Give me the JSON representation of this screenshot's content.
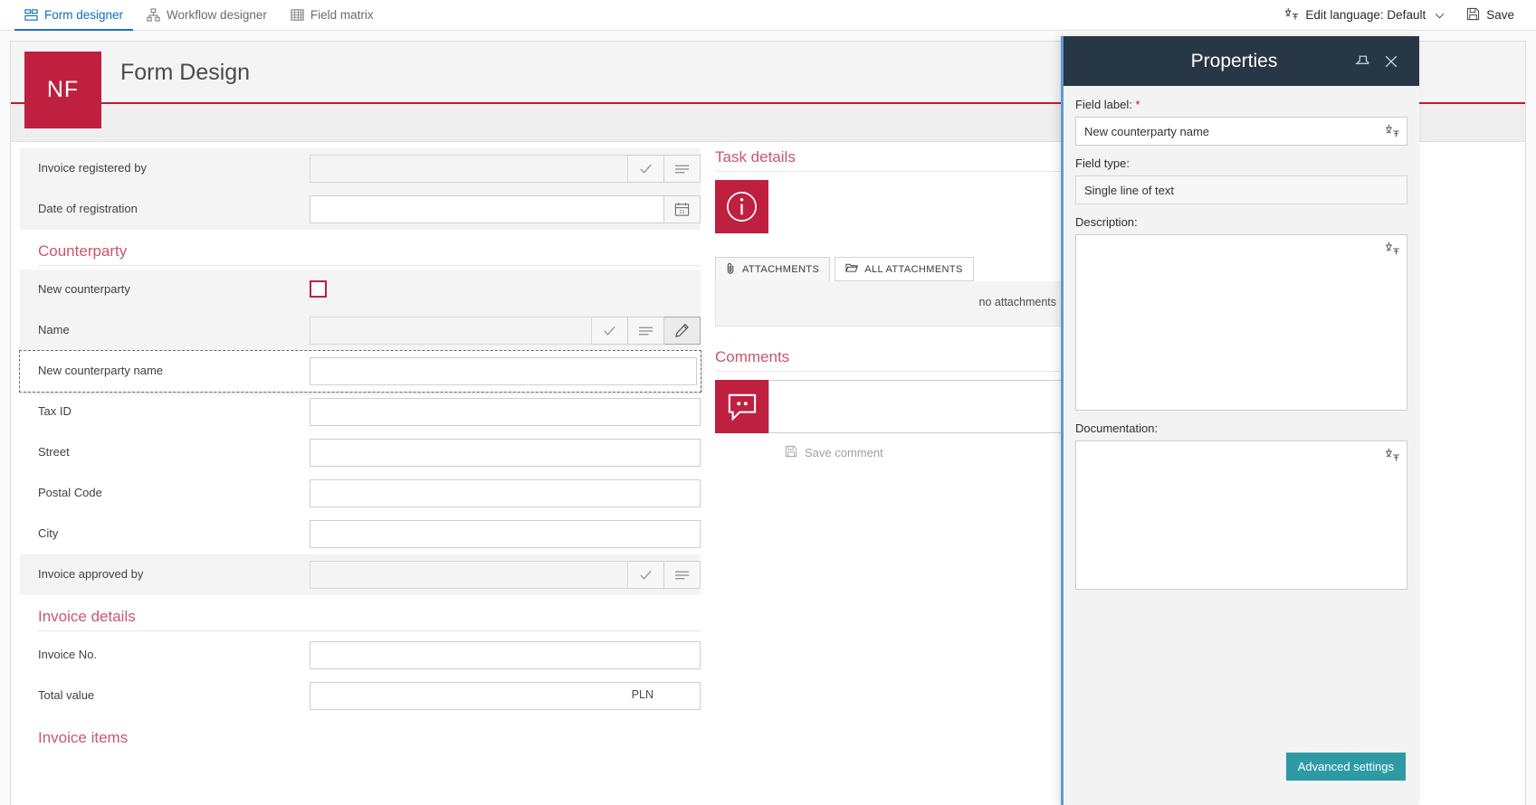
{
  "topbar": {
    "tabs": [
      {
        "label": "Form designer",
        "icon": "form-designer-icon",
        "active": true
      },
      {
        "label": "Workflow designer",
        "icon": "workflow-designer-icon",
        "active": false
      },
      {
        "label": "Field matrix",
        "icon": "field-matrix-icon",
        "active": false
      }
    ],
    "edit_language": "Edit language: Default",
    "save": "Save"
  },
  "form": {
    "logo": "NF",
    "title": "Form Design"
  },
  "left_column": {
    "rows": [
      {
        "label": "Invoice registered by",
        "type": "person",
        "readonly": true,
        "shaded": true
      },
      {
        "label": "Date of registration",
        "type": "date",
        "readonly": false,
        "shaded": true
      },
      {
        "section": "Counterparty"
      },
      {
        "label": "New counterparty",
        "type": "checkbox",
        "shaded": true
      },
      {
        "label": "Name",
        "type": "person-edit",
        "readonly": true,
        "shaded": true
      },
      {
        "label": "New counterparty name",
        "type": "text",
        "selected": true
      },
      {
        "label": "Tax ID",
        "type": "text",
        "shaded": false
      },
      {
        "label": "Street",
        "type": "text",
        "shaded": false
      },
      {
        "label": "Postal Code",
        "type": "text",
        "shaded": false
      },
      {
        "label": "City",
        "type": "text",
        "shaded": false
      },
      {
        "label": "Invoice approved by",
        "type": "person",
        "readonly": true,
        "shaded": true
      },
      {
        "section": "Invoice details"
      },
      {
        "label": "Invoice No.",
        "type": "text",
        "shaded": false
      },
      {
        "label": "Total value",
        "type": "text",
        "suffix": "PLN",
        "shaded": false
      },
      {
        "section": "Invoice items"
      }
    ]
  },
  "middle_column": {
    "task_details_heading": "Task details",
    "attachments_tabs": [
      {
        "label": "ATTACHMENTS",
        "icon": "paperclip-icon",
        "active": true
      },
      {
        "label": "ALL ATTACHMENTS",
        "icon": "folder-icon",
        "active": false
      }
    ],
    "no_attachments": "no attachments",
    "comments_heading": "Comments",
    "save_comment": "Save comment"
  },
  "properties": {
    "title": "Properties",
    "pin_icon": "pin-icon",
    "close_icon": "close-icon",
    "field_label_caption": "Field label:",
    "field_label_value": "New counterparty name",
    "field_type_caption": "Field type:",
    "field_type_value": "Single line of text",
    "description_caption": "Description:",
    "description_value": "",
    "documentation_caption": "Documentation:",
    "documentation_value": "",
    "advanced_settings": "Advanced settings",
    "accent_color": "#2e9ba4",
    "header_color": "#273746"
  }
}
